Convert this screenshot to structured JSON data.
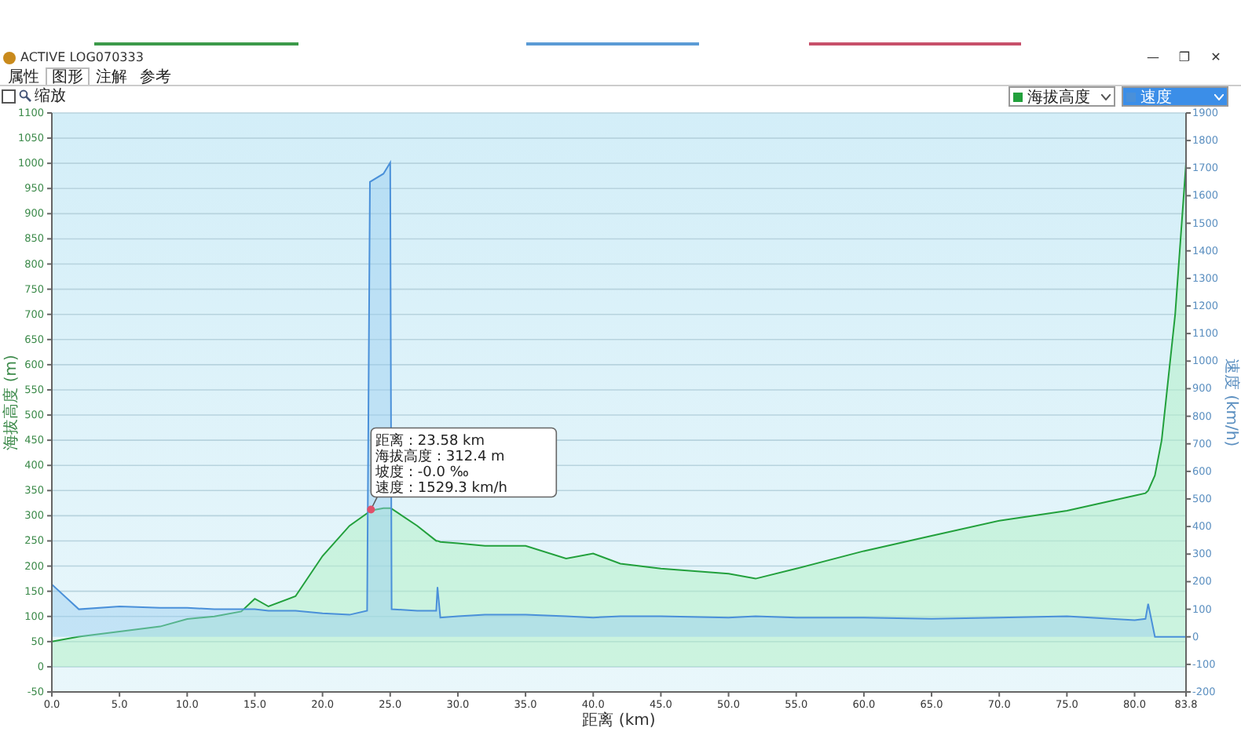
{
  "window": {
    "title": "ACTIVE LOG070333",
    "controls": [
      "—",
      "❐",
      "✕"
    ]
  },
  "tabs": [
    {
      "label": "属性",
      "selected": false
    },
    {
      "label": "图形",
      "selected": true
    },
    {
      "label": "注解",
      "selected": false
    },
    {
      "label": "参考",
      "selected": false
    }
  ],
  "toolbar": {
    "zoom_checkbox": {
      "checked": false
    },
    "zoom_label": "缩放"
  },
  "selectors": [
    {
      "selected": false
    },
    {
      "selected": true
    }
  ],
  "chart": {
    "chart_data": {
      "type": "area",
      "grid": true,
      "xlabel": "距离 (km)",
      "ylabel": "海拔高度 (m)",
      "y2label": "速度 (km/h)",
      "x": [
        0,
        2,
        5,
        8,
        10,
        12,
        14,
        15,
        16,
        18,
        20,
        22,
        23.3,
        23.5,
        24.5,
        25,
        25.1,
        27,
        28.4,
        28.5,
        28.7,
        30,
        32,
        35,
        38,
        40,
        42,
        45,
        50,
        52,
        55,
        60,
        65,
        70,
        75,
        80,
        80.8,
        81,
        81.5,
        82,
        83,
        83.8
      ],
      "series": [
        {
          "name": "海拔高度",
          "color": "#22a03c",
          "values": [
            50,
            60,
            70,
            80,
            95,
            100,
            110,
            135,
            120,
            140,
            220,
            280,
            305,
            310,
            315,
            315,
            314,
            280,
            250,
            250,
            248,
            245,
            240,
            240,
            215,
            225,
            205,
            195,
            185,
            175,
            195,
            230,
            260,
            290,
            310,
            340,
            345,
            350,
            380,
            450,
            700,
            1000
          ]
        },
        {
          "name": "速度",
          "color": "#4a90d9",
          "axis": "y2",
          "values": [
            190,
            100,
            110,
            105,
            105,
            100,
            100,
            100,
            95,
            95,
            85,
            80,
            95,
            1650,
            1680,
            1720,
            100,
            95,
            95,
            180,
            70,
            75,
            80,
            80,
            75,
            70,
            75,
            75,
            70,
            75,
            70,
            70,
            65,
            70,
            75,
            60,
            65,
            120,
            0,
            0,
            0,
            0
          ]
        }
      ],
      "xlim": [
        0,
        83.8
      ],
      "ylim": [
        -50,
        1100
      ],
      "y2lim": [
        -200,
        1900
      ],
      "xticks": [
        {
          "value": 0,
          "label": "0.0"
        },
        {
          "value": 5,
          "label": "5.0"
        },
        {
          "value": 10,
          "label": "10.0"
        },
        {
          "value": 15,
          "label": "15.0"
        },
        {
          "value": 20,
          "label": "20.0"
        },
        {
          "value": 25,
          "label": "25.0"
        },
        {
          "value": 30,
          "label": "30.0"
        },
        {
          "value": 35,
          "label": "35.0"
        },
        {
          "value": 40,
          "label": "40.0"
        },
        {
          "value": 45,
          "label": "45.0"
        },
        {
          "value": 50,
          "label": "50.0"
        },
        {
          "value": 55,
          "label": "55.0"
        },
        {
          "value": 60,
          "label": "60.0"
        },
        {
          "value": 65,
          "label": "65.0"
        },
        {
          "value": 70,
          "label": "70.0"
        },
        {
          "value": 75,
          "label": "75.0"
        },
        {
          "value": 80,
          "label": "80.0"
        },
        {
          "value": 83.8,
          "label": "83.8"
        }
      ],
      "yticks": [
        -50,
        0,
        50,
        100,
        150,
        200,
        250,
        300,
        350,
        400,
        450,
        500,
        550,
        600,
        650,
        700,
        750,
        800,
        850,
        900,
        950,
        1000,
        1050,
        1100
      ],
      "y2ticks": [
        -200,
        -100,
        0,
        100,
        200,
        300,
        400,
        500,
        600,
        700,
        800,
        900,
        1000,
        1100,
        1200,
        1300,
        1400,
        1500,
        1600,
        1700,
        1800,
        1900
      ],
      "annotations": [
        {
          "x": 23.58,
          "y": 312.4,
          "text": "距离 : 23.58 km\n海拔高度 : 312.4 m\n坡度 : -0.0 ‰\n速度 : 1529.3 km/h"
        }
      ]
    }
  }
}
